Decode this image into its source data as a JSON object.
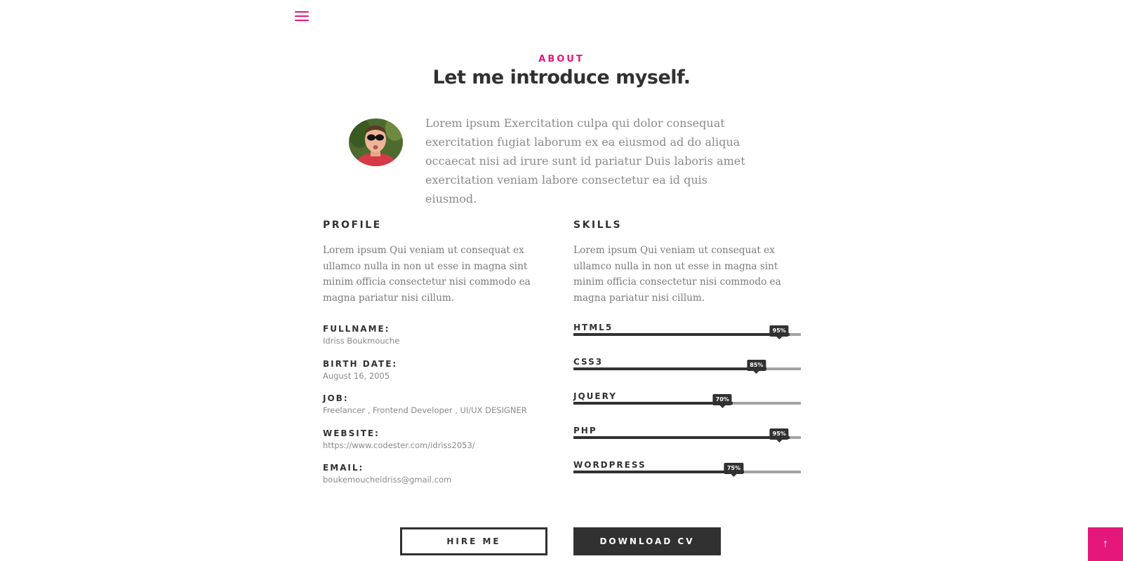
{
  "nav": {
    "menu_icon": "hamburger-icon",
    "accent": "#e6177a"
  },
  "about": {
    "label": "ABOUT",
    "title": "Let me introduce myself.",
    "intro": "Lorem ipsum Exercitation culpa qui dolor consequat exercitation fugiat laborum ex ea eiusmod ad do aliqua occaecat nisi ad irure sunt id pariatur Duis laboris amet exercitation veniam labore consectetur ea id quis eiusmod."
  },
  "profile": {
    "title": "PROFILE",
    "text": "Lorem ipsum Qui veniam ut consequat ex ullamco nulla in non ut esse in magna sint minim officia consectetur nisi commodo ea magna pariatur nisi cillum.",
    "items": [
      {
        "label": "FULLNAME:",
        "value": "Idriss Boukmouche"
      },
      {
        "label": "BIRTH DATE:",
        "value": "August 16, 2005"
      },
      {
        "label": "JOB:",
        "value": "Freelancer , Frontend Developer , UI/UX DESIGNER"
      },
      {
        "label": "WEBSITE:",
        "value": "https://www.codester.com/idriss2053/"
      },
      {
        "label": "EMAIL:",
        "value": "boukemoucheidriss@gmail.com"
      }
    ]
  },
  "skills": {
    "title": "SKILLS",
    "text": "Lorem ipsum Qui veniam ut consequat ex ullamco nulla in non ut esse in magna sint minim officia consectetur nisi commodo ea magna pariatur nisi cillum.",
    "items": [
      {
        "name": "HTML5",
        "percent_label": "95%",
        "percent": 95
      },
      {
        "name": "CSS3",
        "percent_label": "85%",
        "percent": 85
      },
      {
        "name": "JQUERY",
        "percent_label": "70%",
        "percent": 70
      },
      {
        "name": "PHP",
        "percent_label": "95%",
        "percent": 95
      },
      {
        "name": "WORDPRESS",
        "percent_label": "75%",
        "percent": 75
      }
    ]
  },
  "buttons": {
    "hire": "HIRE ME",
    "download": "DOWNLOAD CV"
  },
  "back_to_top": {
    "icon": "arrow-up-icon",
    "glyph": "↑"
  }
}
